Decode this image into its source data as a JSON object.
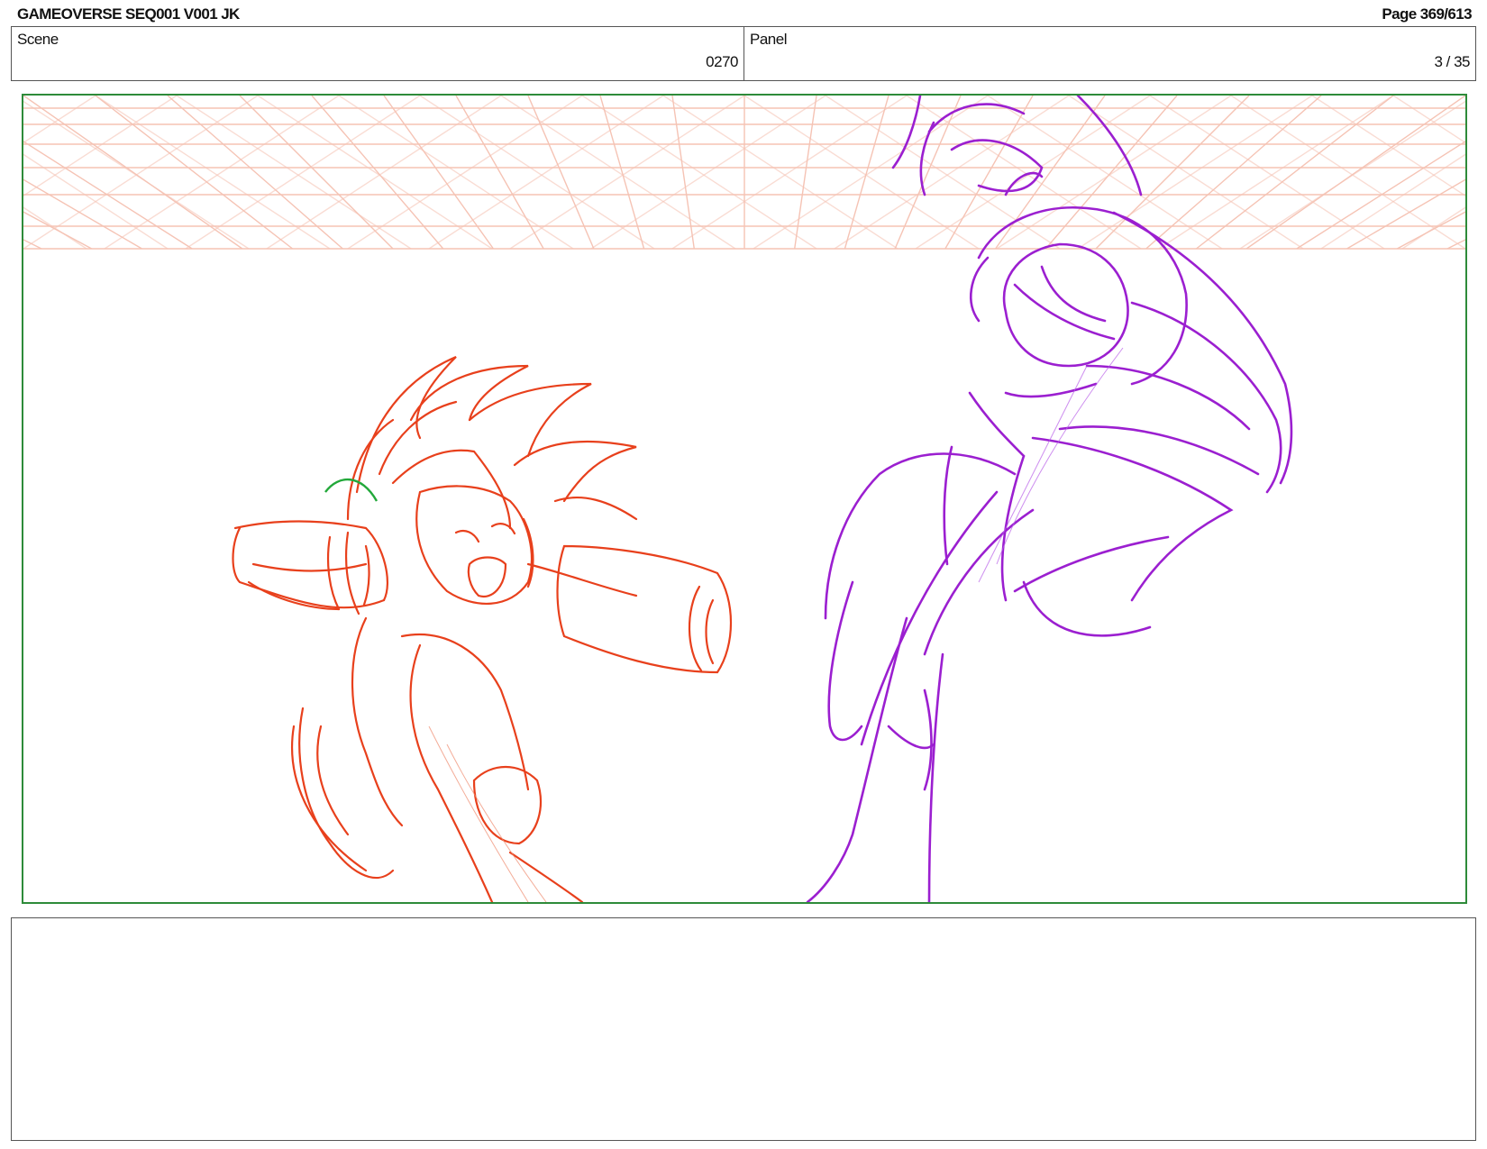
{
  "header": {
    "title": "GAMEOVERSE SEQ001 V001 JK",
    "page": "Page 369/613"
  },
  "scene": {
    "label": "Scene",
    "value": "0270"
  },
  "panel": {
    "label": "Panel",
    "value": "3 / 35"
  },
  "notes": {
    "text": ""
  },
  "colors": {
    "frame_border": "#2e8b3a",
    "hero_sketch": "#e8401c",
    "villain_sketch": "#9b1fd0",
    "grid_lines": "#f4b9a8",
    "accent_green": "#22a83a"
  }
}
